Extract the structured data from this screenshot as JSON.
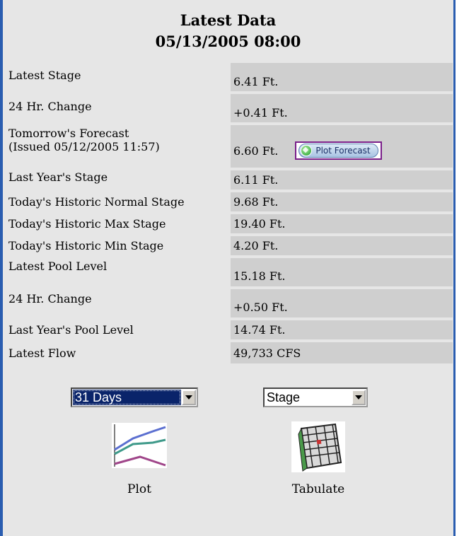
{
  "header": {
    "title": "Latest Data",
    "datetime": "05/13/2005 08:00"
  },
  "rows": [
    {
      "label": "Latest Stage",
      "value": "6.41 Ft."
    },
    {
      "label": "24 Hr. Change",
      "value": "+0.41 Ft."
    },
    {
      "label": "Tomorrow's Forecast",
      "label2": "(Issued 05/12/2005 11:57)",
      "value": "6.60 Ft."
    },
    {
      "label": "Last Year's Stage",
      "value": "6.11 Ft."
    },
    {
      "label": "Today's Historic Normal Stage",
      "value": "9.68 Ft."
    },
    {
      "label": "Today's Historic Max Stage",
      "value": "19.40 Ft."
    },
    {
      "label": "Today's Historic Min Stage",
      "value": "4.20 Ft."
    },
    {
      "label": "Latest Pool Level",
      "value": "15.18 Ft."
    },
    {
      "label": "24 Hr. Change",
      "value": "+0.50 Ft."
    },
    {
      "label": "Last Year's Pool Level",
      "value": "14.74 Ft."
    },
    {
      "label": "Latest Flow",
      "value": "49,733 CFS"
    }
  ],
  "plot_forecast_button": "Plot Forecast",
  "controls": {
    "period_select": "31 Days",
    "type_select": "Stage",
    "plot_label": "Plot",
    "tabulate_label": "Tabulate"
  },
  "icons": {
    "plot_button": "green-diamond-icon",
    "plot": "line-chart-icon",
    "tabulate": "table-sheet-icon"
  },
  "colors": {
    "border": "#2a5db0",
    "panel_bg": "#e6e6e6",
    "value_bg": "#cfcfcf",
    "button_border": "#7a1f8a"
  }
}
